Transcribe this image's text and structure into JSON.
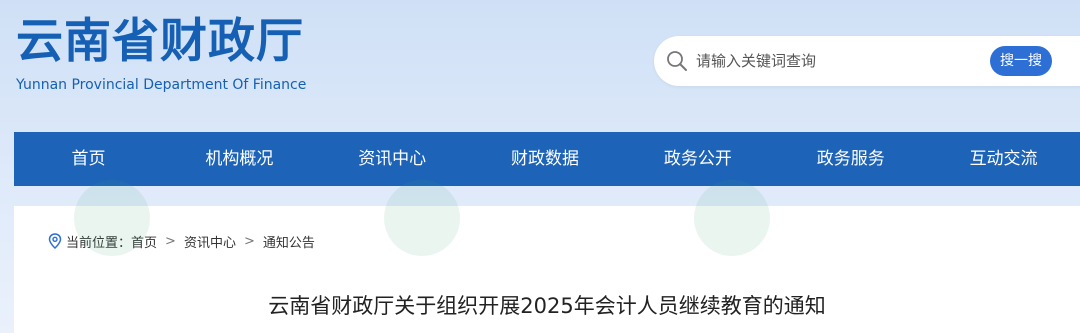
{
  "header": {
    "logo_cn": "云南省财政厅",
    "logo_en": "Yunnan Provincial Department Of Finance"
  },
  "search": {
    "placeholder": "请输入关键词查询",
    "button_label": "搜一搜"
  },
  "nav": {
    "items": [
      {
        "label": "首页"
      },
      {
        "label": "机构概况"
      },
      {
        "label": "资讯中心"
      },
      {
        "label": "财政数据"
      },
      {
        "label": "政务公开"
      },
      {
        "label": "政务服务"
      },
      {
        "label": "互动交流"
      }
    ]
  },
  "breadcrumb": {
    "prefix": "当前位置：",
    "items": [
      "首页",
      "资讯中心",
      "通知公告"
    ],
    "separator": ">"
  },
  "article": {
    "title": "云南省财政厅关于组织开展2025年会计人员继续教育的通知"
  },
  "colors": {
    "brand": "#1560b4",
    "nav_bg": "#1d64b8",
    "search_button": "#2e6fd6"
  }
}
